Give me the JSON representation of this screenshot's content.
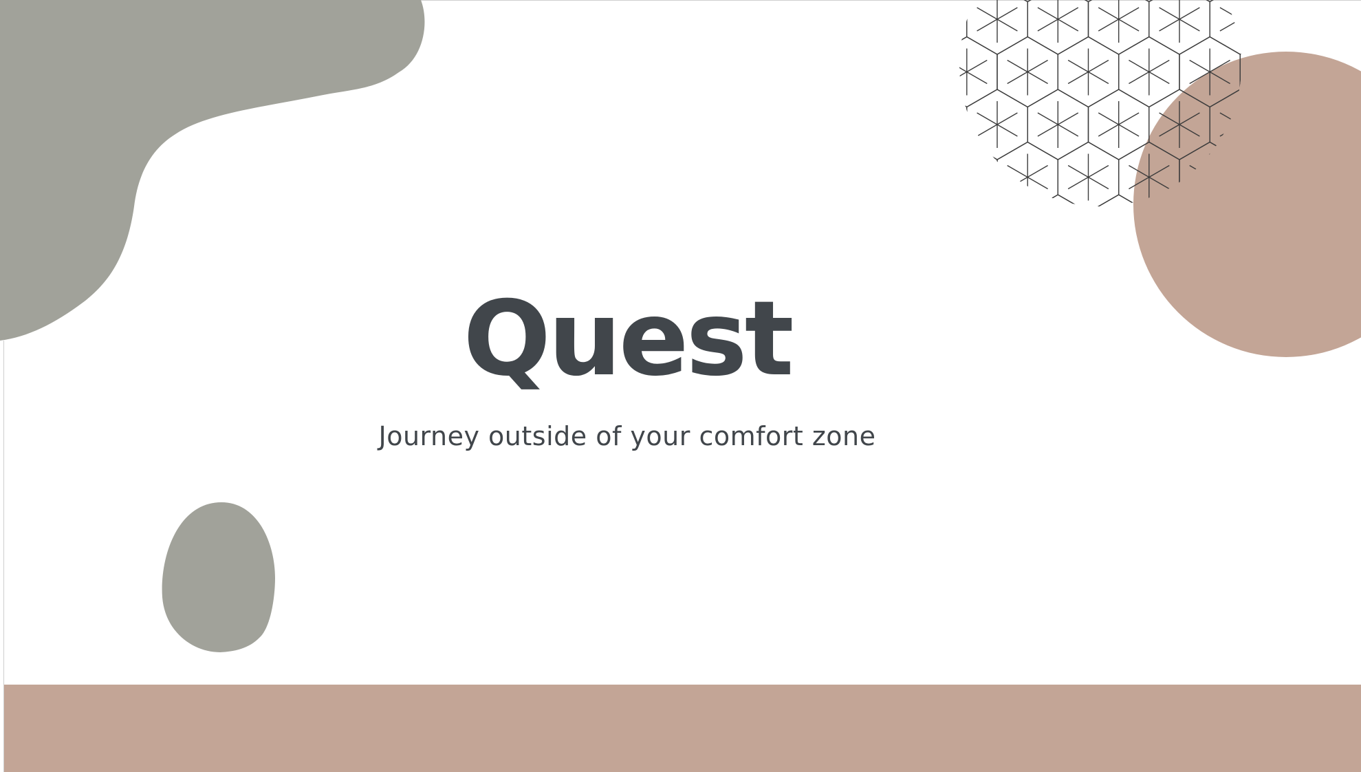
{
  "slide": {
    "title": "Quest",
    "subtitle": "Journey outside of your comfort zone"
  },
  "colors": {
    "text": "#41464b",
    "blob_gray": "#a1a29a",
    "accent_tan": "#c3a596",
    "pattern_line": "#3c3c3c",
    "background": "#ffffff"
  }
}
